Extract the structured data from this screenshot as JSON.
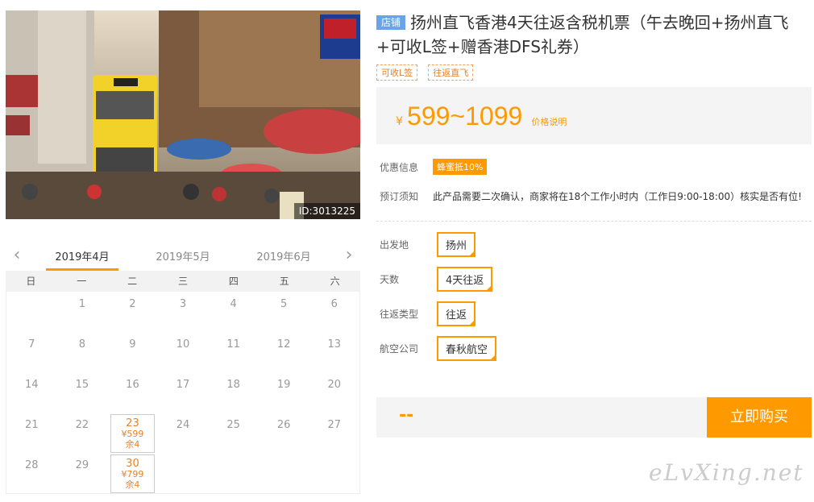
{
  "photo": {
    "id_label": "ID:3013225"
  },
  "calendar": {
    "prev_arrow": "‹",
    "next_arrow": "›",
    "months": [
      "2019年4月",
      "2019年5月",
      "2019年6月"
    ],
    "weekdays": [
      "日",
      "一",
      "二",
      "三",
      "四",
      "五",
      "六"
    ],
    "weeks": [
      [
        {
          "d": ""
        },
        {
          "d": "1"
        },
        {
          "d": "2"
        },
        {
          "d": "3"
        },
        {
          "d": "4"
        },
        {
          "d": "5"
        },
        {
          "d": "6"
        }
      ],
      [
        {
          "d": "7"
        },
        {
          "d": "8"
        },
        {
          "d": "9"
        },
        {
          "d": "10"
        },
        {
          "d": "11"
        },
        {
          "d": "12"
        },
        {
          "d": "13"
        }
      ],
      [
        {
          "d": "14"
        },
        {
          "d": "15"
        },
        {
          "d": "16"
        },
        {
          "d": "17"
        },
        {
          "d": "18"
        },
        {
          "d": "19"
        },
        {
          "d": "20"
        }
      ],
      [
        {
          "d": "21"
        },
        {
          "d": "22"
        },
        {
          "d": "23",
          "price": "¥599",
          "stock": "余4"
        },
        {
          "d": "24"
        },
        {
          "d": "25"
        },
        {
          "d": "26"
        },
        {
          "d": "27"
        }
      ],
      [
        {
          "d": "28"
        },
        {
          "d": "29"
        },
        {
          "d": "30",
          "price": "¥799",
          "stock": "余4"
        },
        {
          "d": ""
        },
        {
          "d": ""
        },
        {
          "d": ""
        },
        {
          "d": ""
        }
      ]
    ]
  },
  "product": {
    "shop_badge": "店铺",
    "title": "扬州直飞香港4天往返含税机票（午去晚回+扬州直飞+可收L签+赠香港DFS礼券）",
    "tags": [
      "可收L签",
      "往返直飞"
    ],
    "price_symbol": "¥",
    "price_range": "599~1099",
    "price_note": "价格说明",
    "promo_label": "优惠信息",
    "promo_badge": "蜂蜜抵10%",
    "notice_label": "预订须知",
    "notice_text": "此产品需要二次确认，商家将在18个工作小时内（工作日9:00-18:00）核实是否有位!"
  },
  "options": [
    {
      "label": "出发地",
      "value": "扬州"
    },
    {
      "label": "天数",
      "value": "4天往返"
    },
    {
      "label": "往返类型",
      "value": "往返"
    },
    {
      "label": "航空公司",
      "value": "春秋航空"
    }
  ],
  "buy": {
    "price": "--",
    "button": "立即购买"
  },
  "watermark": "eLvXing.net",
  "colors": {
    "accent": "#ff9900",
    "shop_badge": "#6aa3e6"
  }
}
